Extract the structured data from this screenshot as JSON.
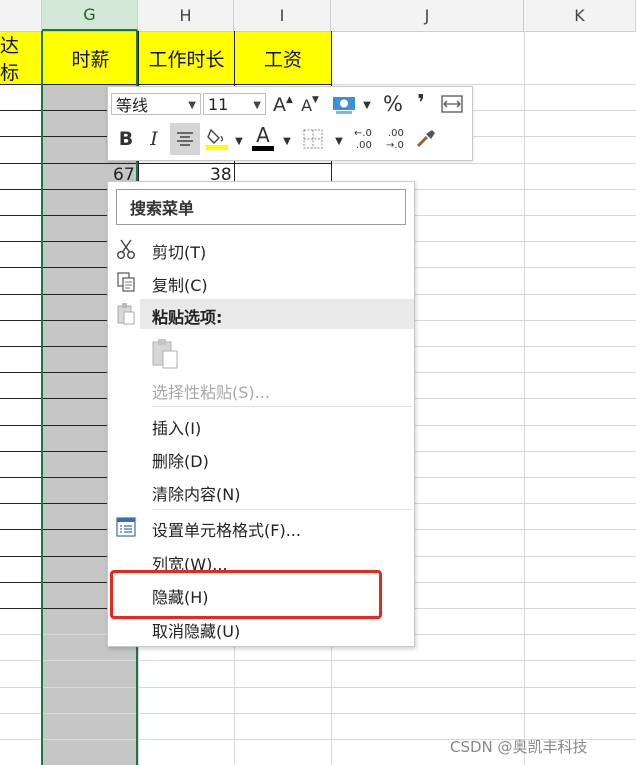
{
  "columns": [
    {
      "id": "F",
      "label": ""
    },
    {
      "id": "G",
      "label": "G"
    },
    {
      "id": "H",
      "label": "H"
    },
    {
      "id": "I",
      "label": "I"
    },
    {
      "id": "J",
      "label": "J"
    },
    {
      "id": "K",
      "label": "K"
    }
  ],
  "header_cells": {
    "f": "达标",
    "g": "时薪",
    "h": "工作时长",
    "i": "工资"
  },
  "visible_values": {
    "g_row4": "67",
    "h_row4": "38"
  },
  "mini_toolbar": {
    "font_name": "等线",
    "font_size": "11",
    "grow_font": "A",
    "shrink_font": "A",
    "percent": "%",
    "comma": "❜",
    "bold": "B",
    "italic": "I",
    "font_color_glyph": "A",
    "inc_decimal": "←.0 .00",
    "dec_decimal": ".00 →.0",
    "fill_color": "#ffff00",
    "font_color": "#000000"
  },
  "context_menu": {
    "search_placeholder": "搜索菜单",
    "items": [
      {
        "label": "剪切(T)",
        "icon": "scissors-icon"
      },
      {
        "label": "复制(C)",
        "icon": "copy-icon"
      },
      {
        "label": "粘贴选项:",
        "icon": "paste-icon"
      },
      {
        "label": "选择性粘贴(S)...",
        "icon": ""
      },
      {
        "label": "插入(I)",
        "icon": ""
      },
      {
        "label": "删除(D)",
        "icon": ""
      },
      {
        "label": "清除内容(N)",
        "icon": ""
      },
      {
        "label": "设置单元格格式(F)...",
        "icon": "format-cells-icon"
      },
      {
        "label": "列宽(W)...",
        "icon": ""
      },
      {
        "label": "隐藏(H)",
        "icon": ""
      },
      {
        "label": "取消隐藏(U)",
        "icon": ""
      }
    ]
  },
  "highlight_color": "#e8271f",
  "watermark": "CSDN @奥凯丰科技"
}
